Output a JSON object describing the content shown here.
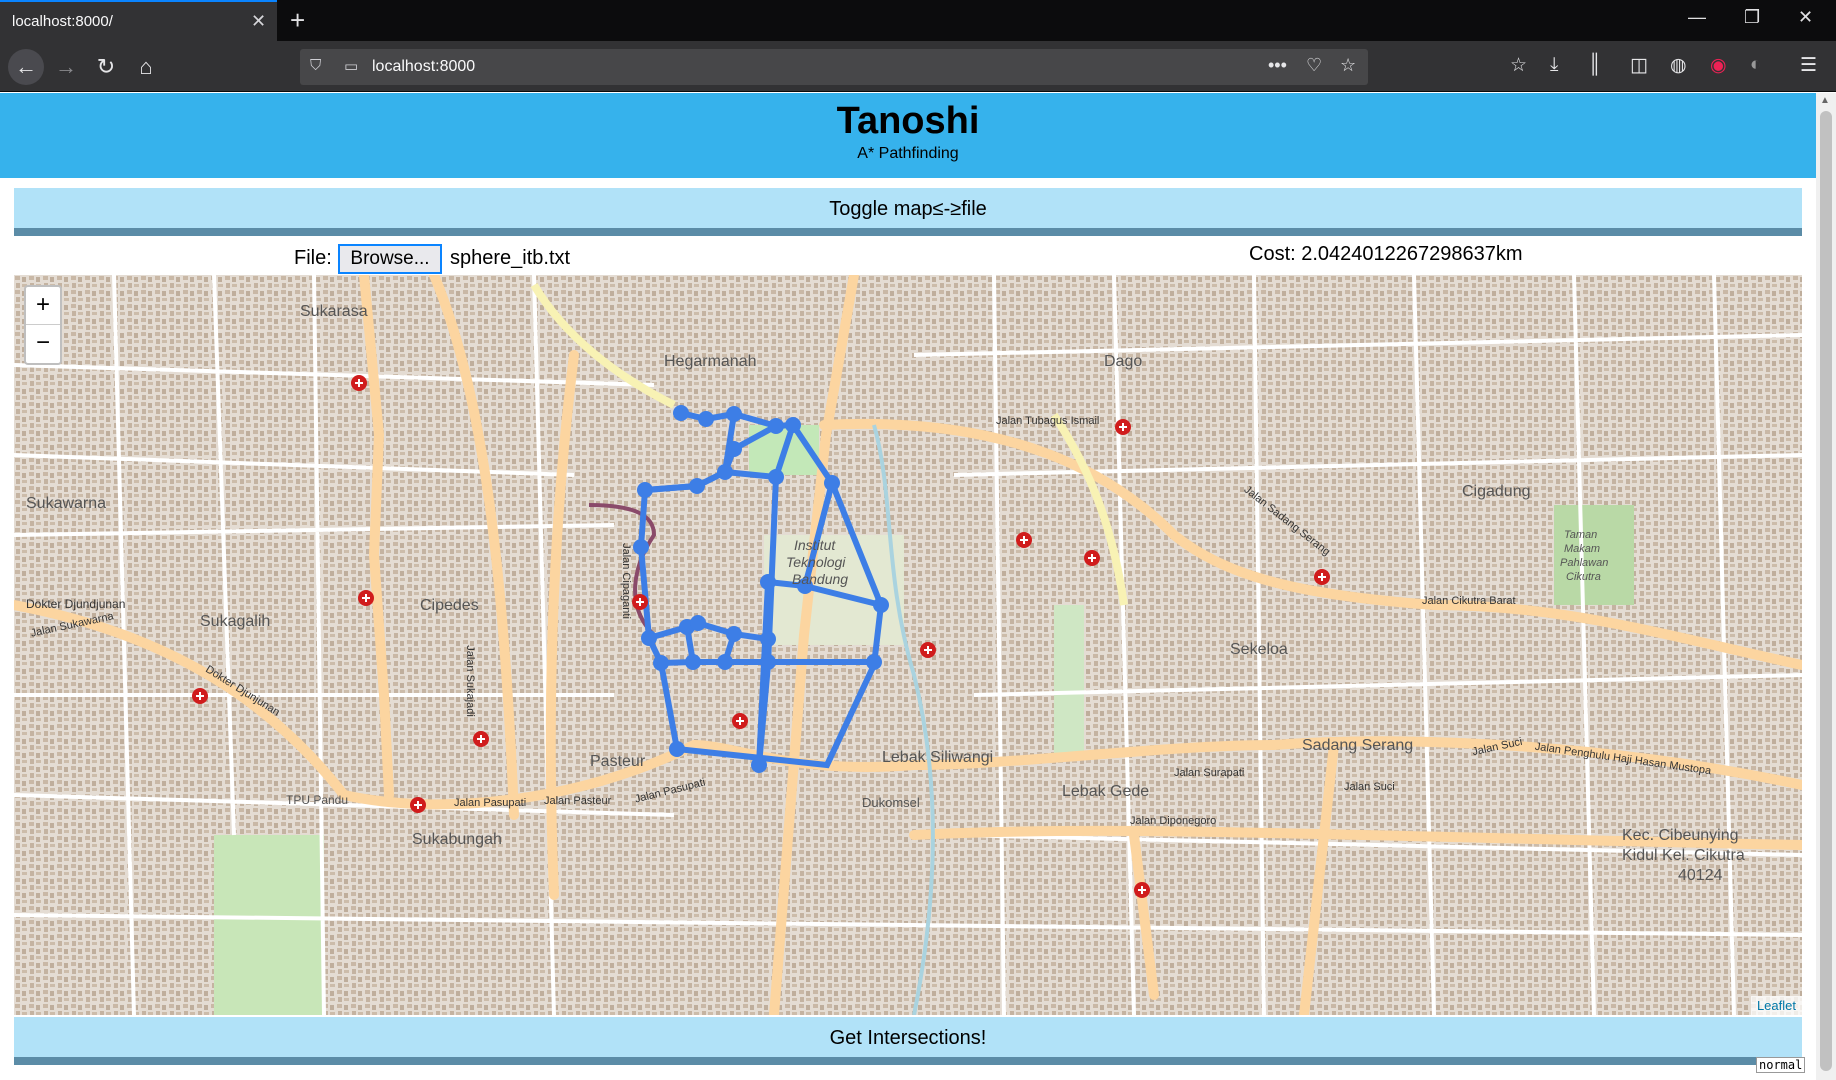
{
  "browser": {
    "tab_title": "localhost:8000/",
    "url": "localhost:8000",
    "icons": [
      "close-icon",
      "plus-icon",
      "back-arrow-icon",
      "forward-arrow-icon",
      "reload-icon",
      "home-icon",
      "shield-icon",
      "page-icon",
      "more-icon",
      "pocket-icon",
      "star-icon",
      "bookmark-icon",
      "download-icon",
      "library-icon",
      "sidebar-icon",
      "menu-icon"
    ]
  },
  "header": {
    "title": "Tanoshi",
    "subtitle": "A* Pathfinding"
  },
  "controls": {
    "toggle_label": "Toggle map≤-≥file",
    "file_label": "File:",
    "browse_label": "Browse...",
    "file_name": "sphere_itb.txt",
    "cost_text": "Cost: 2.0424012267298637km",
    "get_intersections_label": "Get Intersections!",
    "status_tag": "normal"
  },
  "map": {
    "zoom_in": "+",
    "zoom_out": "−",
    "attribution": "Leaflet",
    "route_color": "#3d7ee6",
    "area_labels": {
      "sukarasa": "Sukarasa",
      "hegarmanah": "Hegarmanah",
      "dago": "Dago",
      "sukawarna": "Sukawarna",
      "cigadung": "Cigadung",
      "sukagalih": "Sukagalih",
      "cipedes": "Cipedes",
      "sekeloa": "Sekeloa",
      "pasteur": "Pasteur",
      "lebak_siliwangi": "Lebak Siliwangi",
      "lebak_gede": "Lebak Gede",
      "sadang_serang": "Sadang Serang",
      "dukomsel": "Dukomsel",
      "sukabungah": "Sukabungah",
      "tpu_pandu": "TPU Pandu",
      "itb_1": "Institut",
      "itb_2": "Teknologi",
      "itb_3": "Bandung",
      "taman_1": "Taman",
      "taman_2": "Makam",
      "taman_3": "Pahlawan",
      "taman_4": "Cikutra",
      "kec_1": "Kec. Cibeunying",
      "kec_2": "Kidul Kel. Cikutra",
      "kec_3": "40124"
    },
    "road_labels": {
      "dokter_djundjunan": "Dokter Djundjunan",
      "dokter_djunjunan_2": "Dokter Djunjunan",
      "pasupati_1": "Jalan Pasupati",
      "pasteur_road": "Jalan Pasteur",
      "pasupati_2": "Jalan Pasupati",
      "tubagus": "Jalan Tubagus Ismail",
      "cikutra_barat": "Jalan Cikutra Barat",
      "surapati": "Jalan Surapati",
      "suci_1": "Jalan Suci",
      "suci_2": "Jalan Suci",
      "penghulu": "Jalan Penghulu Haji Hasan Mustopa",
      "diponegoro": "Jalan Diponegoro",
      "sadang_serang_road": "Jalan Sadang Serang",
      "sukawarna_road": "Jalan Sukawarna",
      "sukajadi": "Jalan Sukajadi",
      "cipaganti": "Jalan Cipaganti"
    }
  }
}
